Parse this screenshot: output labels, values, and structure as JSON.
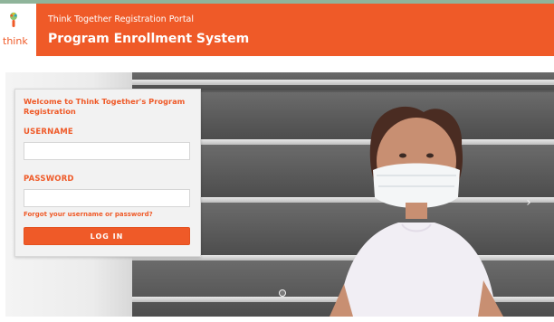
{
  "header": {
    "subtitle": "Think Together Registration Portal",
    "title": "Program Enrollment System",
    "logo_text": "think",
    "colors": {
      "accent": "#ef5a28",
      "top_strip": "#8fb49a"
    }
  },
  "login": {
    "welcome": "Welcome to Think Together's Program Registration",
    "username_label": "USERNAME",
    "username_value": "",
    "username_placeholder": "",
    "password_label": "PASSWORD",
    "password_value": "",
    "password_placeholder": "",
    "forgot_link": "Forgot your username or password?",
    "login_button": "LOG IN"
  },
  "hero": {
    "next_icon": "chevron-right-icon",
    "next_glyph": "›",
    "dot_icon": "carousel-dot-icon"
  }
}
